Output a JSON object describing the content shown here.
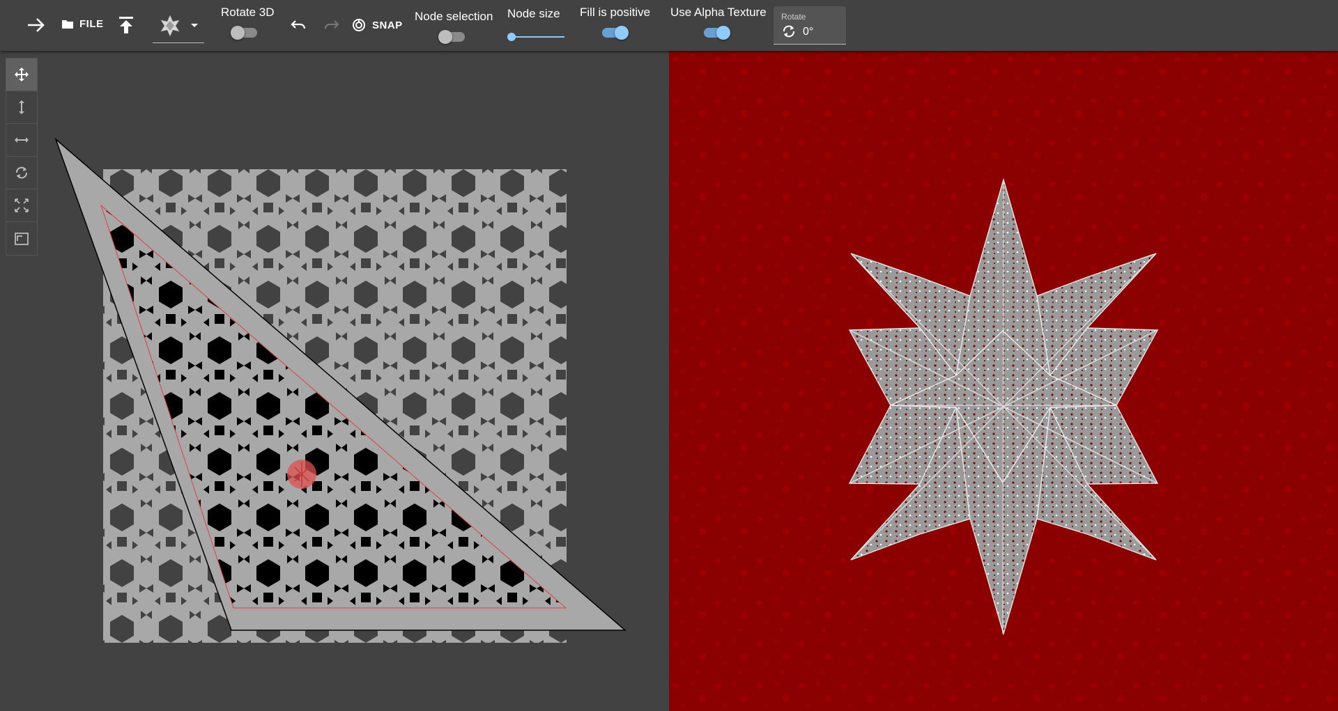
{
  "toolbar": {
    "file_label": "FILE",
    "snap_label": "SNAP",
    "rotate3d_label": "Rotate 3D",
    "node_selection_label": "Node selection",
    "node_size_label": "Node size",
    "fill_positive_label": "Fill is positive",
    "alpha_texture_label": "Use Alpha Texture",
    "rotate_caption": "Rotate",
    "rotate_value": "0°",
    "rotate3d_on": false,
    "node_selection_on": false,
    "fill_positive_on": true,
    "alpha_texture_on": true,
    "node_size_level": 0.0
  },
  "side_tools": [
    {
      "name": "move-icon",
      "active": true
    },
    {
      "name": "scale-vertical-icon",
      "active": false
    },
    {
      "name": "scale-horizontal-icon",
      "active": false
    },
    {
      "name": "rotate-icon",
      "active": false
    },
    {
      "name": "fit-icon",
      "active": false
    },
    {
      "name": "frame-icon",
      "active": false
    }
  ],
  "colors": {
    "toolbar_bg": "#424242",
    "accent": "#90caf9",
    "texture_bg": "#8b0000",
    "tile_gray": "#a9a9a9",
    "marker_red": "#e05050"
  }
}
